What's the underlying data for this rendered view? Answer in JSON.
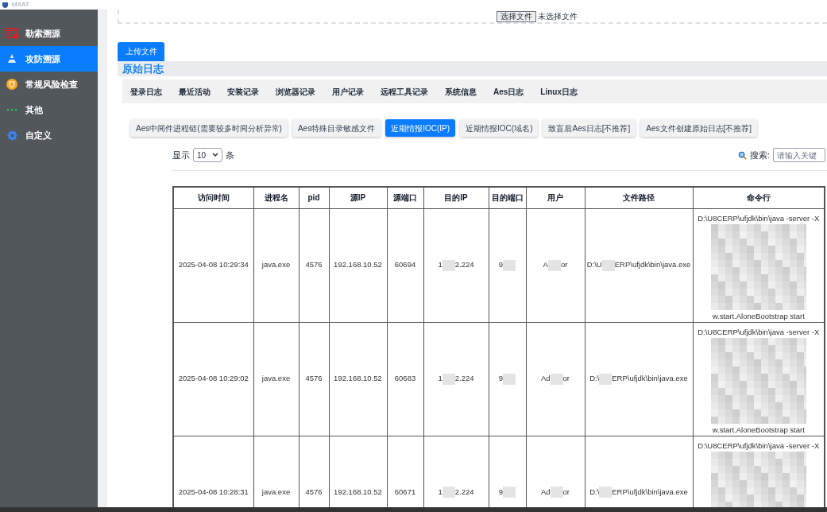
{
  "app": {
    "title": "MXAT"
  },
  "sidebar": {
    "items": [
      {
        "label": "勒索溯源",
        "selected": false,
        "kind": "ransom"
      },
      {
        "label": "攻防溯源",
        "selected": true,
        "kind": "hacker"
      },
      {
        "label": "常规风险检查",
        "selected": false,
        "kind": "shield"
      },
      {
        "label": "其他",
        "selected": false,
        "kind": "dots"
      },
      {
        "label": "自定义",
        "selected": false,
        "kind": "gear"
      }
    ]
  },
  "upload": {
    "choose_button": "选择文件",
    "file_status": "未选择文件",
    "upload_button": "上传文件"
  },
  "section_title": "原始日志",
  "tabs": [
    {
      "label": "登录日志",
      "selected": false
    },
    {
      "label": "最近活动",
      "selected": false
    },
    {
      "label": "安装记录",
      "selected": false
    },
    {
      "label": "浏览器记录",
      "selected": false
    },
    {
      "label": "用户记录",
      "selected": false
    },
    {
      "label": "远程工具记录",
      "selected": false
    },
    {
      "label": "系统信息",
      "selected": false
    },
    {
      "label": "Aes日志",
      "selected": false
    },
    {
      "label": "Linux日志",
      "selected": false
    }
  ],
  "sub_tabs": [
    {
      "label": "Aes中间件进程链(需要较多时间分析异常)",
      "selected": false
    },
    {
      "label": "Aes特殊目录敏感文件",
      "selected": false
    },
    {
      "label": "近期情报IOC(IP)",
      "selected": true
    },
    {
      "label": "近期情报IOC(域名)",
      "selected": false
    },
    {
      "label": "致盲后Aes日志[不推荐]",
      "selected": false
    },
    {
      "label": "Aes文件创建原始日志[不推荐]",
      "selected": false
    }
  ],
  "page_size": {
    "prefix": "显示",
    "value": "10",
    "suffix": "条"
  },
  "search": {
    "label": "搜索:",
    "placeholder": "请输入关键"
  },
  "table": {
    "columns": [
      "访问时间",
      "进程名",
      "pid",
      "源IP",
      "源端口",
      "目的IP",
      "目的端口",
      "用户",
      "文件路径",
      "命令行"
    ],
    "rows": [
      {
        "cells": [
          [
            {
              "kind": "text",
              "text": "2025-04-08 10:29:34"
            }
          ],
          [
            {
              "kind": "text",
              "text": "java.exe"
            }
          ],
          [
            {
              "kind": "text",
              "text": "4576"
            }
          ],
          [
            {
              "kind": "text",
              "text": "192.168.10.52"
            }
          ],
          [
            {
              "kind": "text",
              "text": "60694"
            }
          ],
          [
            {
              "kind": "text",
              "text": "1"
            },
            {
              "kind": "mask"
            },
            {
              "kind": "text",
              "text": "2.224"
            }
          ],
          [
            {
              "kind": "text",
              "text": "9"
            },
            {
              "kind": "mask"
            }
          ],
          [
            {
              "kind": "text",
              "text": "A"
            },
            {
              "kind": "mask"
            },
            {
              "kind": "text",
              "text": "or"
            }
          ],
          [
            {
              "kind": "text",
              "text": "D:\\U"
            },
            {
              "kind": "mask"
            },
            {
              "kind": "text",
              "text": "ERP\\ufjdk\\bin\\java.exe"
            }
          ]
        ],
        "command": {
          "head": "D:\\U8CERP\\ufjdk\\bin\\java -server -X",
          "tail": "w.start.AloneBootstrap start"
        }
      },
      {
        "cells": [
          [
            {
              "kind": "text",
              "text": "2025-04-08 10:29:02"
            }
          ],
          [
            {
              "kind": "text",
              "text": "java.exe"
            }
          ],
          [
            {
              "kind": "text",
              "text": "4576"
            }
          ],
          [
            {
              "kind": "text",
              "text": "192.168.10.52"
            }
          ],
          [
            {
              "kind": "text",
              "text": "60683"
            }
          ],
          [
            {
              "kind": "text",
              "text": "1"
            },
            {
              "kind": "mask"
            },
            {
              "kind": "text",
              "text": "2.224"
            }
          ],
          [
            {
              "kind": "text",
              "text": "9"
            },
            {
              "kind": "mask"
            }
          ],
          [
            {
              "kind": "text",
              "text": "Ad"
            },
            {
              "kind": "mask"
            },
            {
              "kind": "text",
              "text": "or"
            }
          ],
          [
            {
              "kind": "text",
              "text": "D:\\"
            },
            {
              "kind": "mask"
            },
            {
              "kind": "text",
              "text": "ERP\\ufjdk\\bin\\java.exe"
            }
          ]
        ],
        "command": {
          "head": "D:\\U8CERP\\ufjdk\\bin\\java -server -X",
          "tail": "w.start.AloneBootstrap start"
        }
      },
      {
        "cells": [
          [
            {
              "kind": "text",
              "text": "2025-04-08 10:28:31"
            }
          ],
          [
            {
              "kind": "text",
              "text": "java.exe"
            }
          ],
          [
            {
              "kind": "text",
              "text": "4576"
            }
          ],
          [
            {
              "kind": "text",
              "text": "192.168.10.52"
            }
          ],
          [
            {
              "kind": "text",
              "text": "60671"
            }
          ],
          [
            {
              "kind": "text",
              "text": "1"
            },
            {
              "kind": "mask"
            },
            {
              "kind": "text",
              "text": "2.224"
            }
          ],
          [
            {
              "kind": "text",
              "text": "9"
            },
            {
              "kind": "mask"
            }
          ],
          [
            {
              "kind": "text",
              "text": "Ad"
            },
            {
              "kind": "mask"
            },
            {
              "kind": "text",
              "text": "or"
            }
          ],
          [
            {
              "kind": "text",
              "text": "D:\\"
            },
            {
              "kind": "mask"
            },
            {
              "kind": "text",
              "text": "ERP\\ufjdk\\bin\\java.exe"
            }
          ]
        ],
        "command": {
          "head": "D:\\U8CERP\\ufjdk\\bin\\java -server -X"
        }
      }
    ]
  }
}
